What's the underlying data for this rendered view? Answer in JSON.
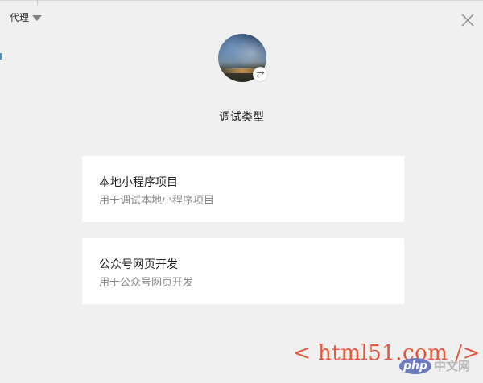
{
  "header": {
    "proxy_label": "代理"
  },
  "profile": {
    "avatar_icon": "avatar",
    "switch_icon": "swap-arrows-icon"
  },
  "main": {
    "title": "调试类型",
    "cards": [
      {
        "title": "本地小程序项目",
        "description": "用于调试本地小程序项目"
      },
      {
        "title": "公众号网页开发",
        "description": "用于公众号网页开发"
      }
    ]
  },
  "watermark": {
    "text": "< html51.com />",
    "logo_text": "php",
    "site_text": "中文网"
  },
  "colors": {
    "background": "#f0f0f0",
    "card": "#ffffff",
    "watermark": "#e8553a"
  }
}
